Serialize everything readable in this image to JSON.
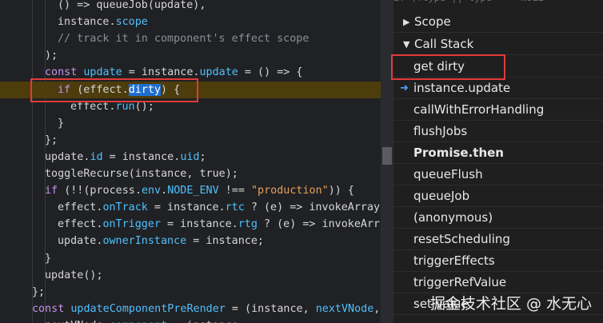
{
  "editor": {
    "lines": [
      [
        [
          "() => queueJob(update),",
          ""
        ]
      ],
      [
        [
          "instance.",
          ""
        ],
        [
          "scope",
          "prop"
        ]
      ],
      [
        [
          "// track it in component's effect scope",
          "cm"
        ]
      ],
      [
        [
          ");",
          ""
        ]
      ],
      [
        [
          "const ",
          "kw"
        ],
        [
          "update",
          "prop"
        ],
        [
          " = instance.",
          ""
        ],
        [
          "update",
          "prop"
        ],
        [
          " = () => {",
          ""
        ]
      ],
      [
        [
          "if ",
          "kw"
        ],
        [
          "(effect.",
          ""
        ],
        [
          "dirty",
          "sel"
        ],
        [
          ") {",
          ""
        ]
      ],
      [
        [
          "effect.",
          ""
        ],
        [
          "run",
          "prop"
        ],
        [
          "();",
          ""
        ]
      ],
      [
        [
          "}",
          ""
        ]
      ],
      [
        [
          "};",
          ""
        ]
      ],
      [
        [
          "update.",
          ""
        ],
        [
          "id",
          "prop"
        ],
        [
          " = instance.",
          ""
        ],
        [
          "uid",
          "prop"
        ],
        [
          ";",
          ""
        ]
      ],
      [
        [
          "toggleRecurse(instance, true);",
          ""
        ]
      ],
      [
        [
          "if ",
          "kw"
        ],
        [
          "(!!(process.",
          ""
        ],
        [
          "env",
          "prop"
        ],
        [
          ".",
          ""
        ],
        [
          "NODE_ENV",
          "prop"
        ],
        [
          " !== ",
          ""
        ],
        [
          "\"production\"",
          "str"
        ],
        [
          ")) {",
          ""
        ]
      ],
      [
        [
          "effect.",
          ""
        ],
        [
          "onTrack",
          "prop"
        ],
        [
          " = instance.",
          ""
        ],
        [
          "rtc",
          "prop"
        ],
        [
          " ? (e) => invokeArray",
          ""
        ]
      ],
      [
        [
          "effect.",
          ""
        ],
        [
          "onTrigger",
          "prop"
        ],
        [
          " = instance.",
          ""
        ],
        [
          "rtg",
          "prop"
        ],
        [
          " ? (e) => invokeArr",
          ""
        ]
      ],
      [
        [
          "update.",
          ""
        ],
        [
          "ownerInstance",
          "prop"
        ],
        [
          " = instance;",
          ""
        ]
      ],
      [
        [
          "}",
          ""
        ]
      ],
      [
        [
          "update();",
          ""
        ]
      ],
      [
        [
          "};",
          ""
        ]
      ],
      [
        [
          "const ",
          "kw"
        ],
        [
          "updateComponentPreRender",
          "prop"
        ],
        [
          " = (instance, ",
          ""
        ],
        [
          "nextVNode",
          "prop"
        ],
        [
          ", ",
          ""
        ]
      ],
      [
        [
          "nextVNode.",
          ""
        ],
        [
          "component",
          "prop"
        ],
        [
          " = instance;",
          ""
        ]
      ]
    ]
  },
  "debugger": {
    "top_cut_text": "if (!type || type === NULL",
    "sections": {
      "scope": "Scope",
      "call_stack": "Call Stack"
    },
    "frames": [
      "get dirty",
      "instance.update",
      "callWithErrorHandling",
      "flushJobs",
      "Promise.then",
      "queueFlush",
      "queueJob",
      "(anonymous)",
      "resetScheduling",
      "triggerEffects",
      "triggerRefValue",
      "set value"
    ],
    "current_frame": "instance.update",
    "async_separator": "Promise.then"
  },
  "watermark": "掘金技术社区 @ 水无心",
  "colors": {
    "highlight_line": "#4d3c0c",
    "annotation_red": "#e23a3a",
    "current_frame_arrow": "#4ea1ff"
  }
}
